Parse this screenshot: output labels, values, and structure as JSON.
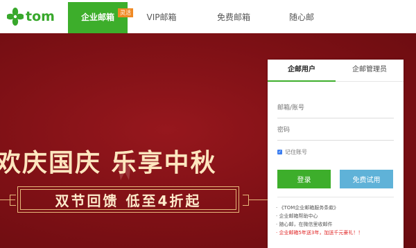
{
  "logo": {
    "text": "tom",
    "icon": "clover-logo-icon",
    "color": "#38a82c"
  },
  "nav": {
    "items": [
      {
        "label": "企业邮箱",
        "badge": "灵活"
      },
      {
        "label": "VIP邮箱"
      },
      {
        "label": "免费邮箱"
      },
      {
        "label": "随心邮"
      }
    ],
    "active_color": "#3dae2b"
  },
  "banner": {
    "title": "欢庆国庆 乐享中秋",
    "subtitle": "双节回馈 低至4折起",
    "background": "#7d1015",
    "text_color": "#fde6bf"
  },
  "login": {
    "tabs": [
      "企邮用户",
      "企邮管理员"
    ],
    "active_tab": 0,
    "username_placeholder": "邮箱/账号",
    "password_placeholder": "密码",
    "remember_label": "记住账号",
    "remember_checked": true,
    "login_button": "登录",
    "trial_button": "免费试用",
    "links": [
      "· 《TOM企业邮箱服务条款》",
      "· 企业邮箱帮助中心",
      "· 随心邮，在微信里收邮件",
      "· 企业邮箱5年送3年，加送千元豪礼！！"
    ],
    "link_highlight_color": "#e02424"
  }
}
